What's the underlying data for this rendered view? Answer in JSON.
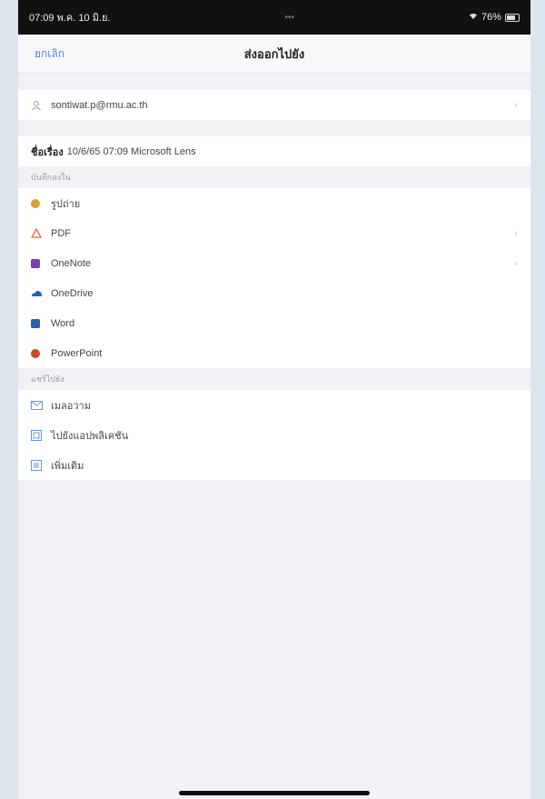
{
  "status": {
    "time": "07:09 พ.ค. 10 มิ.ย.",
    "center": "•••",
    "right": "76%"
  },
  "nav": {
    "back_label": "ยกเลิก",
    "title": "ส่งออกไปยัง"
  },
  "account": {
    "email": "sontiwat.p@rmu.ac.th",
    "chevron": "›"
  },
  "filename": {
    "label": "ชื่อเรื่อง",
    "value": "10/6/65 07:09 Microsoft Lens"
  },
  "save_to": {
    "header": "บันทึกลงใน",
    "items": [
      {
        "label": "รูปถ่าย",
        "icon": "photos-icon",
        "color": "#d8a23a"
      },
      {
        "label": "PDF",
        "icon": "pdf-icon",
        "color": "#e85b3c",
        "chevron": "›"
      },
      {
        "label": "OneNote",
        "icon": "onenote-icon",
        "color": "#7b3fb3",
        "chevron": "›"
      },
      {
        "label": "OneDrive",
        "icon": "onedrive-icon",
        "color": "#1d63c6"
      },
      {
        "label": "Word",
        "icon": "word-icon",
        "color": "#2b5fb3"
      },
      {
        "label": "PowerPoint",
        "icon": "powerpoint-icon",
        "color": "#d24726"
      }
    ]
  },
  "share_to": {
    "header": "แชร์ไปยัง",
    "items": [
      {
        "label": "เมลอวาม",
        "icon": "mail-icon",
        "color": "#6b93d6"
      },
      {
        "label": "ไปยังแอปพลิเคชัน",
        "icon": "app-icon",
        "color": "#6b93d6"
      },
      {
        "label": "เพิ่มเติม",
        "icon": "more-icon",
        "color": "#6b93d6"
      }
    ]
  }
}
